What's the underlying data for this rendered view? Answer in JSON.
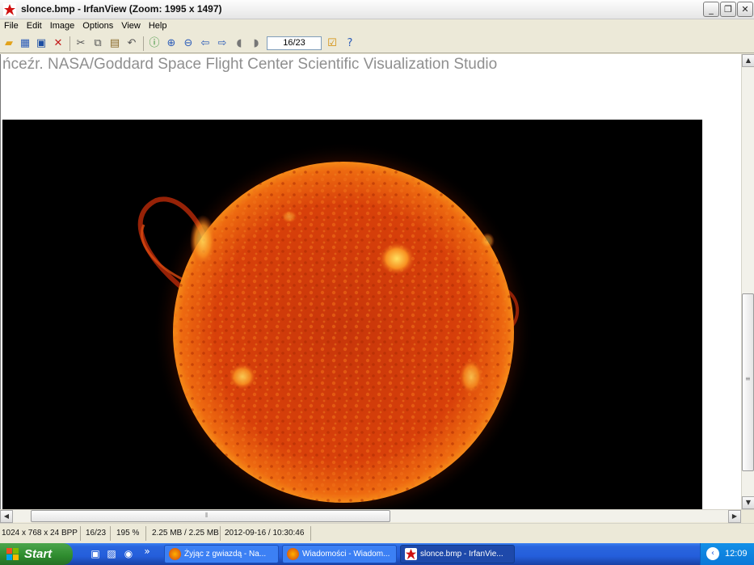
{
  "window": {
    "title": "slonce.bmp - IrfanView (Zoom: 1995 x 1497)",
    "minimize": "_",
    "restore": "❐",
    "close": "✕"
  },
  "menu": [
    "File",
    "Edit",
    "Image",
    "Options",
    "View",
    "Help"
  ],
  "toolbar": {
    "page_value": "16/23"
  },
  "image": {
    "credit_text": "ńceźr. NASA/Goddard Space Flight Center Scientific Visualization Studio"
  },
  "status": {
    "dimensions": "1024 x 768 x 24 BPP",
    "page": "16/23",
    "zoom": "195 %",
    "size": "2.25 MB / 2.25 MB",
    "datetime": "2012-09-16 / 10:30:46"
  },
  "taskbar": {
    "start_label": "Start",
    "tasks": [
      {
        "label": "Żyjąc z gwiazdą - Na...",
        "icon": "firefox-icon"
      },
      {
        "label": "Wiadomości - Wiadom...",
        "icon": "firefox-icon"
      },
      {
        "label": "slonce.bmp - IrfanVie...",
        "icon": "irfanview-icon"
      }
    ],
    "chevron": "»",
    "clock": "12:09"
  },
  "colors": {
    "accent": "#245edb",
    "sun_core": "#d8400a",
    "sun_edge": "#f07a10"
  }
}
